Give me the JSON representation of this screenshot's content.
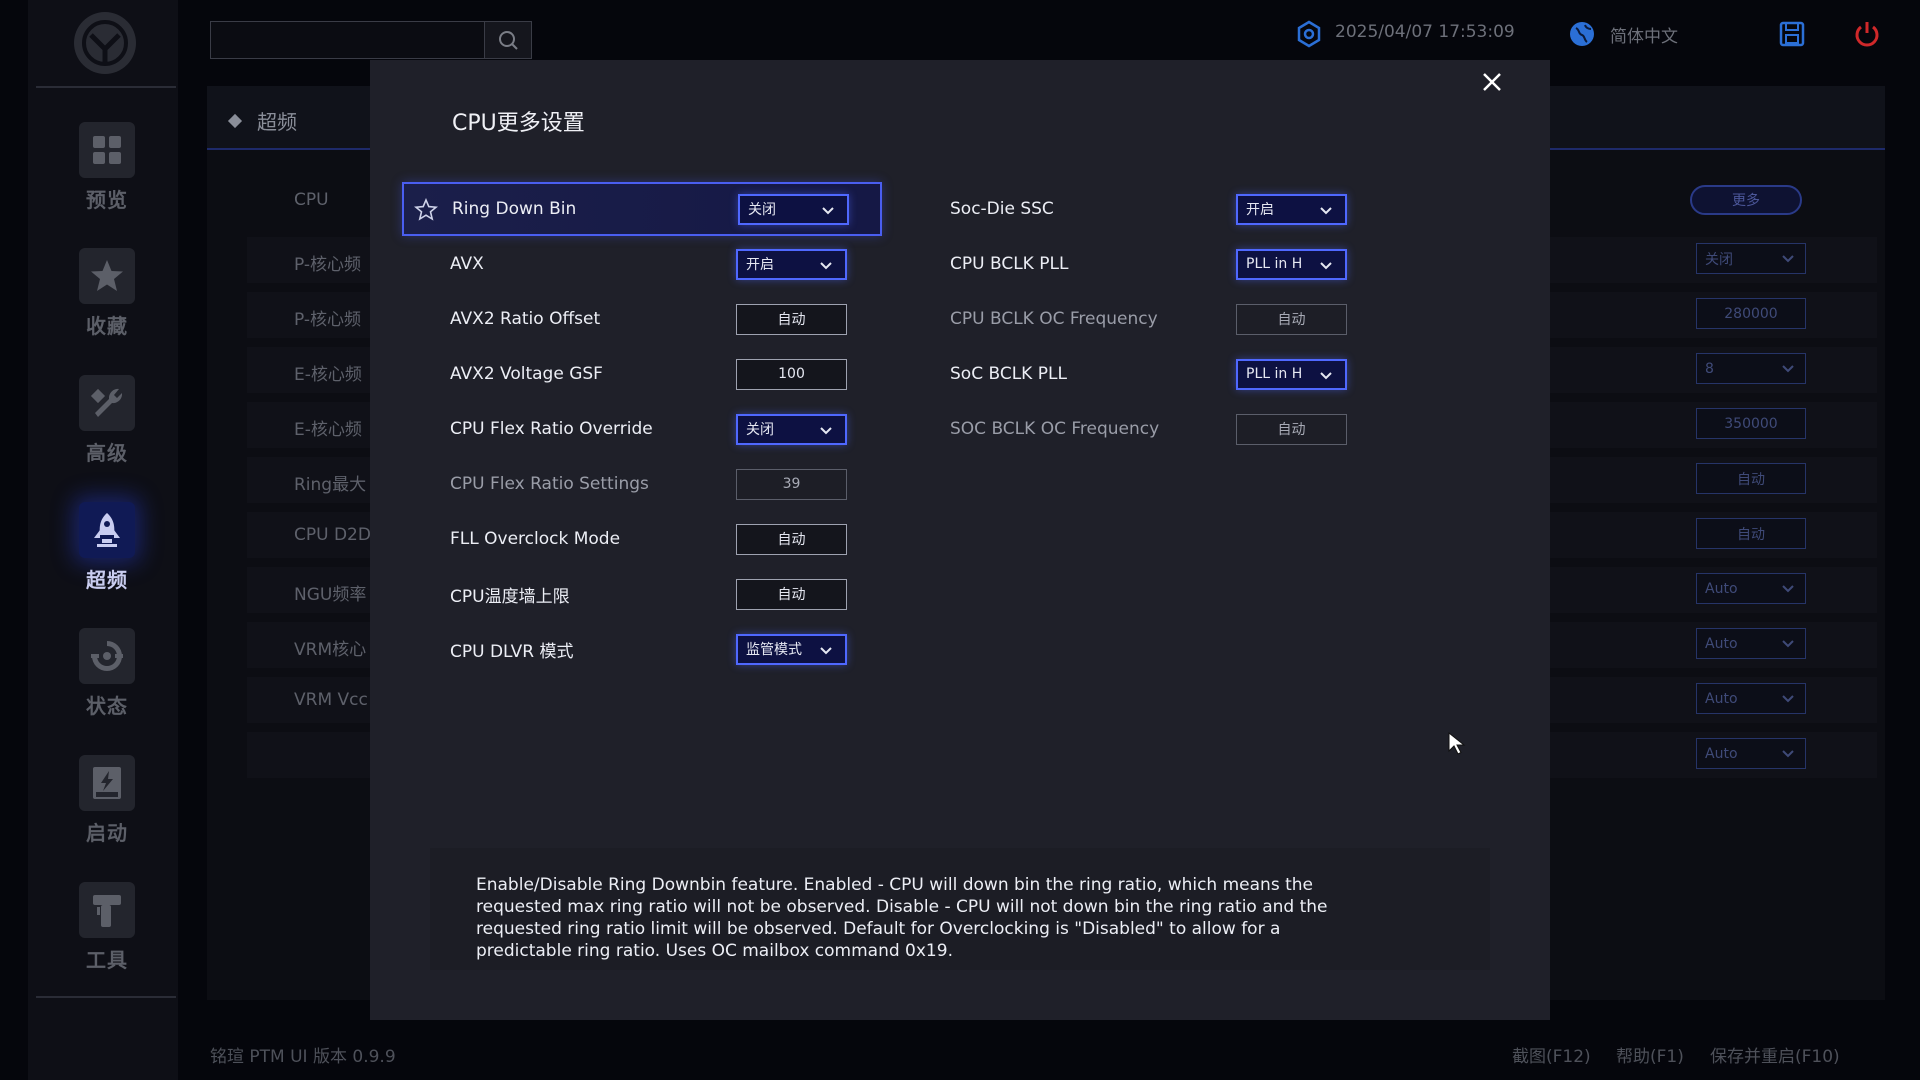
{
  "app": {
    "version_text": "铭瑄 PTM UI 版本 0.9.9",
    "datetime": "2025/04/07 17:53:09",
    "language": "简体中文"
  },
  "sidebar": {
    "items": [
      {
        "label": "预览",
        "icon": "grid-icon",
        "active": false
      },
      {
        "label": "收藏",
        "icon": "star-icon",
        "active": false
      },
      {
        "label": "高级",
        "icon": "wrench-icon",
        "active": false
      },
      {
        "label": "超频",
        "icon": "rocket-icon",
        "active": true
      },
      {
        "label": "状态",
        "icon": "gauge-icon",
        "active": false
      },
      {
        "label": "启动",
        "icon": "ssd-icon",
        "active": false
      },
      {
        "label": "工具",
        "icon": "tools-icon",
        "active": false
      }
    ]
  },
  "main": {
    "breadcrumb": "超频",
    "section_label": "CPU",
    "more_button": "更多",
    "rows": [
      {
        "label": "P-核心频",
        "value": "关闭",
        "kind": "select"
      },
      {
        "label": "P-核心频",
        "value": "280000",
        "kind": "box"
      },
      {
        "label": "E-核心频",
        "value": "8",
        "kind": "select"
      },
      {
        "label": "E-核心频",
        "value": "350000",
        "kind": "box"
      },
      {
        "label": "Ring最大",
        "value": "自动",
        "kind": "box"
      },
      {
        "label": "CPU D2D",
        "value": "自动",
        "kind": "box"
      },
      {
        "label": "NGU频率",
        "value": "Auto",
        "kind": "select"
      },
      {
        "label": "VRM核心",
        "value": "Auto",
        "kind": "select"
      },
      {
        "label": "VRM Vcc",
        "value": "Auto",
        "kind": "select"
      },
      {
        "label": "",
        "value": "Auto",
        "kind": "select"
      }
    ]
  },
  "footer": {
    "screenshot": "截图(F12)",
    "help": "帮助(F1)",
    "save_restart": "保存并重启(F10)"
  },
  "modal": {
    "title": "CPU更多设置",
    "left_rows": [
      {
        "label": "Ring Down Bin",
        "value": "关闭",
        "kind": "select",
        "selected": true
      },
      {
        "label": "AVX",
        "value": "开启",
        "kind": "select"
      },
      {
        "label": "AVX2 Ratio Offset",
        "value": "自动",
        "kind": "box"
      },
      {
        "label": "AVX2 Voltage GSF",
        "value": "100",
        "kind": "box"
      },
      {
        "label": "CPU Flex Ratio Override",
        "value": "关闭",
        "kind": "select"
      },
      {
        "label": "CPU Flex Ratio Settings",
        "value": "39",
        "kind": "box",
        "disabled": true
      },
      {
        "label": "FLL Overclock Mode",
        "value": "自动",
        "kind": "box"
      },
      {
        "label": "CPU温度墙上限",
        "value": "自动",
        "kind": "box"
      },
      {
        "label": "CPU DLVR 模式",
        "value": "监管模式",
        "kind": "select"
      }
    ],
    "right_rows": [
      {
        "label": "Soc-Die SSC",
        "value": "开启",
        "kind": "select"
      },
      {
        "label": "CPU BCLK PLL",
        "value": "PLL in H",
        "kind": "select"
      },
      {
        "label": "CPU BCLK OC Frequency",
        "value": "自动",
        "kind": "box",
        "disabled": true
      },
      {
        "label": "SoC BCLK PLL",
        "value": "PLL in H",
        "kind": "select"
      },
      {
        "label": "SOC BCLK OC Frequency",
        "value": "自动",
        "kind": "box",
        "disabled": true
      }
    ],
    "description": "Enable/Disable Ring Downbin feature. Enabled - CPU will down bin the ring ratio, which means the requested max ring ratio will not be observed. Disable - CPU will not down bin the ring ratio and the requested ring ratio limit will be observed. Default for Overclocking is \"Disabled\" to allow for a predictable ring ratio. Uses OC mailbox command 0x19."
  },
  "colors": {
    "accent": "#4f68ff",
    "selected_row_border": "#4a5ef0",
    "power": "#d0282a"
  }
}
